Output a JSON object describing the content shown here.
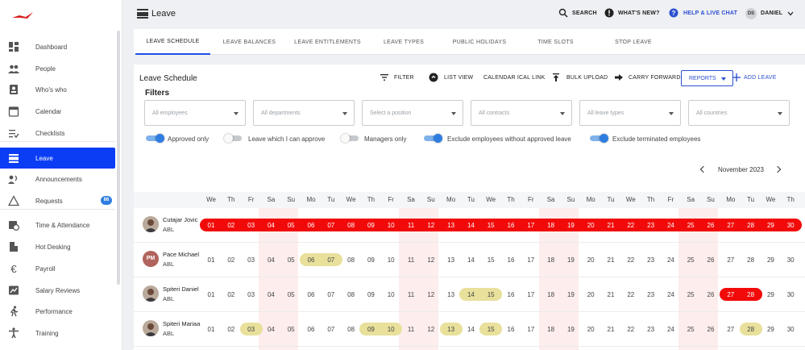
{
  "app": {
    "page_title": "Leave",
    "colors": {
      "accent": "#0b3df5",
      "link": "#2c4fd1",
      "leave_approved": "#f20a0a",
      "leave_pending": "#e8e09b",
      "weekend": "#fbdada"
    }
  },
  "sidebar": {
    "items": [
      {
        "label": "Dashboard",
        "icon": "dashboard-icon"
      },
      {
        "label": "People",
        "icon": "people-icon"
      },
      {
        "label": "Who's who",
        "icon": "contact-card-icon"
      },
      {
        "label": "Calendar",
        "icon": "calendar-icon"
      },
      {
        "label": "Checklists",
        "icon": "checklist-icon"
      },
      {
        "label": "Leave",
        "icon": "leave-icon",
        "active": true
      },
      {
        "label": "Announcements",
        "icon": "megaphone-icon"
      },
      {
        "label": "Requests",
        "icon": "warning-triangle-icon",
        "badge": "86"
      },
      {
        "label": "Time & Attendance",
        "icon": "clock-calendar-icon"
      },
      {
        "label": "Hot Desking",
        "icon": "desk-icon"
      },
      {
        "label": "Payroll",
        "icon": "euro-icon"
      },
      {
        "label": "Salary Reviews",
        "icon": "chart-card-icon"
      },
      {
        "label": "Performance",
        "icon": "running-person-icon"
      },
      {
        "label": "Training",
        "icon": "person-stretch-icon"
      }
    ]
  },
  "topbar": {
    "search": "SEARCH",
    "whats_new": "WHAT'S NEW?",
    "help": "HELP & LIVE CHAT",
    "user_initials": "DS",
    "user_name": "DANIEL"
  },
  "tabs": [
    "LEAVE SCHEDULE",
    "LEAVE BALANCES",
    "LEAVE ENTITLEMENTS",
    "LEAVE TYPES",
    "PUBLIC HOLIDAYS",
    "TIME SLOTS",
    "STOP LEAVE"
  ],
  "schedule": {
    "title": "Leave Schedule",
    "actions": {
      "filter": "FILTER",
      "list_view": "LIST VIEW",
      "ical": "CALENDAR ICAL LINK",
      "bulk_upload": "BULK UPLOAD",
      "carry_forward": "CARRY FORWARD",
      "reports": "REPORTS",
      "add_leave": "ADD LEAVE"
    },
    "filters_title": "Filters",
    "selects": [
      "All employees",
      "All departments",
      "Select a position",
      "All contracts",
      "All leave types",
      "All countries"
    ],
    "toggles": [
      {
        "label": "Approved only",
        "on": true
      },
      {
        "label": "Leave which I can approve",
        "on": false
      },
      {
        "label": "Managers only",
        "on": false
      },
      {
        "label": "Exclude employees without approved leave",
        "on": true
      },
      {
        "label": "Exclude terminated employees",
        "on": true
      }
    ],
    "month": "November 2023",
    "weekdays": [
      "We",
      "Th",
      "Fr",
      "Sa",
      "Su",
      "Mo",
      "Tu",
      "We",
      "Th",
      "Fr",
      "Sa",
      "Su",
      "Mo",
      "Tu",
      "We",
      "Th",
      "Fr",
      "Sa",
      "Su",
      "Mo",
      "Tu",
      "We",
      "Th",
      "Fr",
      "Sa",
      "Su",
      "Mo",
      "Tu",
      "We",
      "Th"
    ],
    "days": [
      "01",
      "02",
      "03",
      "04",
      "05",
      "06",
      "07",
      "08",
      "09",
      "10",
      "11",
      "12",
      "13",
      "14",
      "15",
      "16",
      "17",
      "18",
      "19",
      "20",
      "21",
      "22",
      "23",
      "24",
      "25",
      "26",
      "27",
      "28",
      "29",
      "30"
    ],
    "employees": [
      {
        "name": "Cutajar Jovic",
        "company": "ABL",
        "avatar": "photo",
        "approved": [
          [
            1,
            30
          ]
        ],
        "pending": []
      },
      {
        "name": "Pace Michael",
        "company": "ABL",
        "avatar": "PM",
        "approved": [],
        "pending": [
          [
            6,
            7
          ]
        ]
      },
      {
        "name": "Spiteri Daniel",
        "company": "ABL",
        "avatar": "photo",
        "approved": [
          [
            27,
            28
          ]
        ],
        "pending": [
          [
            14,
            15
          ]
        ]
      },
      {
        "name": "Spiteri Mariaa",
        "company": "ABL",
        "avatar": "photo",
        "approved": [],
        "pending": [
          [
            3,
            3
          ],
          [
            9,
            10
          ],
          [
            13,
            13
          ],
          [
            15,
            15
          ],
          [
            28,
            28
          ]
        ]
      }
    ]
  }
}
